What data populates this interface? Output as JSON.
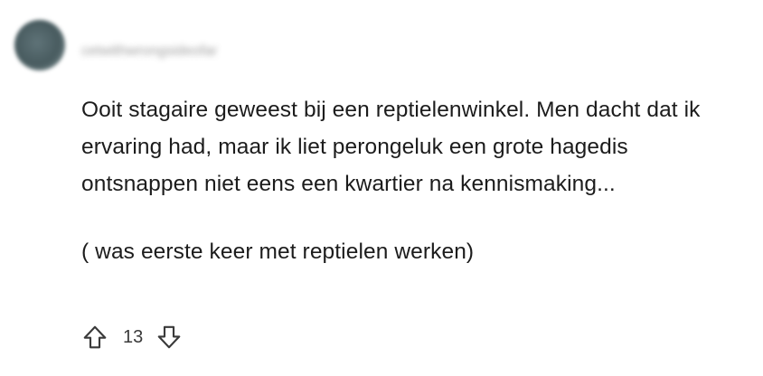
{
  "comment": {
    "author": "cetwithwrongsideofar",
    "paragraphs": [
      "Ooit stagaire geweest bij een reptielenwinkel. Men dacht dat ik ervaring had, maar ik liet perongeluk een grote hagedis ontsnappen niet eens een kwartier na kennismaking...",
      "( was eerste keer met reptielen werken)"
    ],
    "score": "13"
  },
  "icons": {
    "upvote": "arrow-up-outline-icon",
    "downvote": "arrow-down-outline-icon"
  },
  "colors": {
    "text": "#1c1c1c",
    "icon": "#3a3a3a"
  }
}
